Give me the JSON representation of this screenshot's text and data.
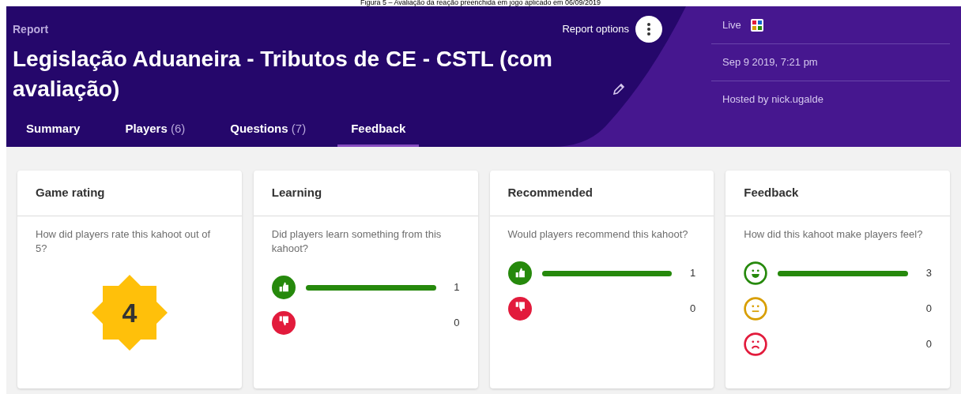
{
  "caption": "Figura 5 – Avaliação da reação preenchida em jogo aplicado em 06/09/2019",
  "header": {
    "label": "Report",
    "title": "Legislação Aduaneira - Tributos de CE - CSTL (com avaliação)",
    "options": "Report options"
  },
  "tabs": [
    {
      "label": "Summary",
      "selected": false
    },
    {
      "label": "Players",
      "count": "(6)",
      "selected": false
    },
    {
      "label": "Questions",
      "count": "(7)",
      "selected": false
    },
    {
      "label": "Feedback",
      "selected": true
    }
  ],
  "info": {
    "status": "Live",
    "date": "Sep 9 2019, 7:21 pm",
    "host": "Hosted by nick.ugalde"
  },
  "cards": [
    {
      "kind": "rating",
      "title": "Game rating",
      "question": "How did players rate this kahoot out of 5?",
      "rating": "4"
    },
    {
      "kind": "bars",
      "title": "Learning",
      "question": "Did players learn something from this kahoot?",
      "rows": [
        {
          "kind": "thumbs-up",
          "color": "#26890c",
          "count": "1"
        },
        {
          "kind": "thumbs-down",
          "color": "#e21b3c",
          "count": "0"
        }
      ]
    },
    {
      "kind": "bars",
      "title": "Recommended",
      "question": "Would players recommend this kahoot?",
      "rows": [
        {
          "kind": "thumbs-up",
          "color": "#26890c",
          "count": "1"
        },
        {
          "kind": "thumbs-down",
          "color": "#e21b3c",
          "count": "0"
        }
      ]
    },
    {
      "kind": "bars",
      "title": "Feedback",
      "question": "How did this kahoot make players feel?",
      "rows": [
        {
          "kind": "happy",
          "color": "#26890c",
          "count": "3"
        },
        {
          "kind": "neutral",
          "color": "#d89e00",
          "count": "0"
        },
        {
          "kind": "sad",
          "color": "#e21b3c",
          "count": "0"
        }
      ]
    }
  ]
}
